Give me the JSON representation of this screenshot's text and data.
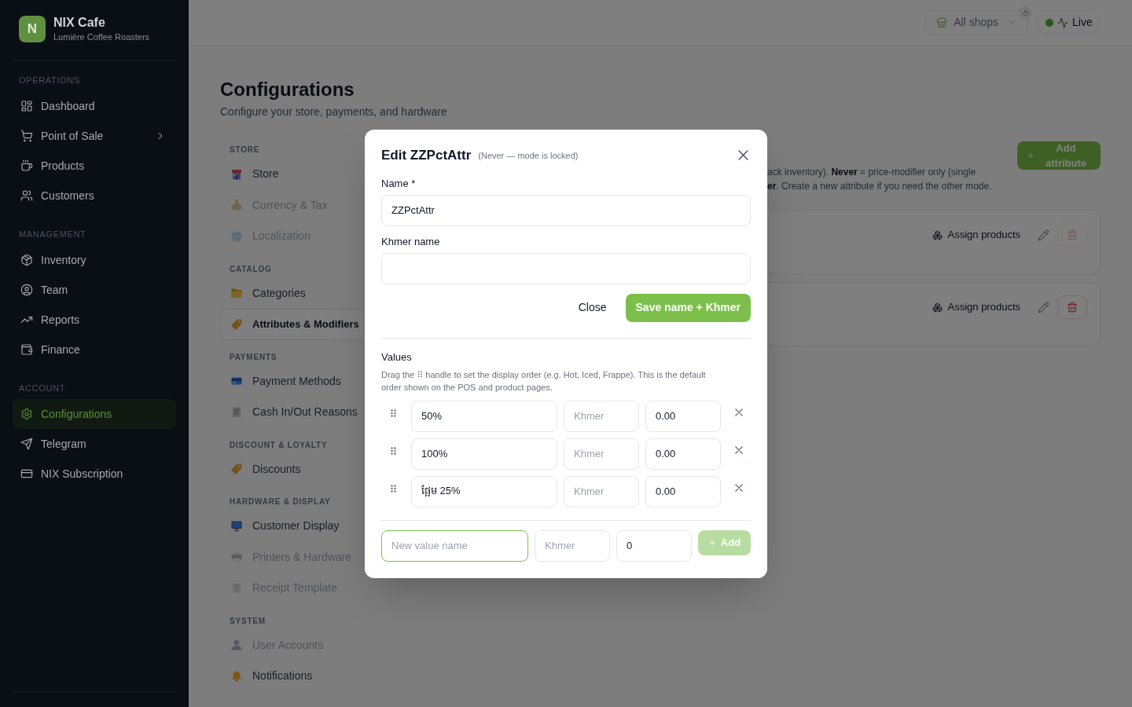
{
  "sidebar": {
    "brand": {
      "initial": "N",
      "name": "NIX Cafe",
      "tagline": "Lumière Coffee Roasters"
    },
    "sections": [
      {
        "title": "OPERATIONS",
        "items": [
          {
            "label": "Dashboard",
            "selected": false,
            "expandable": false
          },
          {
            "label": "Point of Sale",
            "selected": false,
            "expandable": true
          },
          {
            "label": "Products",
            "selected": false,
            "expandable": false
          },
          {
            "label": "Customers",
            "selected": false,
            "expandable": false
          }
        ]
      },
      {
        "title": "MANAGEMENT",
        "items": [
          {
            "label": "Inventory",
            "selected": false,
            "expandable": false
          },
          {
            "label": "Team",
            "selected": false,
            "expandable": false
          },
          {
            "label": "Reports",
            "selected": false,
            "expandable": false
          },
          {
            "label": "Finance",
            "selected": false,
            "expandable": false
          }
        ]
      },
      {
        "title": "ACCOUNT",
        "items": [
          {
            "label": "Configurations",
            "selected": true,
            "expandable": false
          },
          {
            "label": "Telegram",
            "selected": false,
            "expandable": false
          },
          {
            "label": "NIX Subscription",
            "selected": false,
            "expandable": false
          }
        ]
      }
    ]
  },
  "header": {
    "shop_selector": {
      "label": "All shops",
      "locked": true
    },
    "live_status": {
      "label": "Live",
      "on": true
    }
  },
  "page": {
    "title": "Configurations",
    "subtitle": "Configure your store, payments, and hardware"
  },
  "config_nav": {
    "sections": [
      {
        "title": "STORE",
        "items": [
          {
            "label": "Store",
            "selected": false,
            "disabled": false
          },
          {
            "label": "Currency & Tax",
            "selected": false,
            "disabled": true
          },
          {
            "label": "Localization",
            "selected": false,
            "disabled": true
          }
        ]
      },
      {
        "title": "CATALOG",
        "items": [
          {
            "label": "Categories",
            "selected": false,
            "disabled": false
          },
          {
            "label": "Attributes & Modifiers",
            "selected": true,
            "disabled": false
          }
        ]
      },
      {
        "title": "PAYMENTS",
        "items": [
          {
            "label": "Payment Methods",
            "selected": false,
            "disabled": false
          },
          {
            "label": "Cash In/Out Reasons",
            "selected": false,
            "disabled": false
          }
        ]
      },
      {
        "title": "DISCOUNT & LOYALTY",
        "items": [
          {
            "label": "Discounts",
            "selected": false,
            "disabled": false
          }
        ]
      },
      {
        "title": "HARDWARE & DISPLAY",
        "items": [
          {
            "label": "Customer Display",
            "selected": false,
            "disabled": false
          },
          {
            "label": "Printers & Hardware",
            "selected": false,
            "disabled": true
          },
          {
            "label": "Receipt Template",
            "selected": false,
            "disabled": true
          }
        ]
      },
      {
        "title": "SYSTEM",
        "items": [
          {
            "label": "User Accounts",
            "selected": false,
            "disabled": true
          },
          {
            "label": "Notifications",
            "selected": false,
            "disabled": false
          }
        ]
      }
    ]
  },
  "attributes_panel": {
    "add_button": "Add attribute",
    "description_lines": [
      "ack inventory). **Never** = price-modifier only (single",
      "**er**. Create a new attribute if you need the other mode."
    ],
    "cards": [
      {
        "assign_label": "Assign products",
        "delete_disabled": true
      },
      {
        "assign_label": "Assign products",
        "delete_disabled": false
      }
    ]
  },
  "modal": {
    "title": "Edit ZZPctAttr",
    "note": "(Never — mode is locked)",
    "fields": [
      {
        "label": "Name *",
        "value": "ZZPctAttr"
      },
      {
        "label": "Khmer name"
      }
    ],
    "close_button": "Close",
    "save_button": "Save name + Khmer",
    "values": {
      "label": "Values",
      "help": "Drag the ⠿ handle to set the display order (e.g. Hot, Iced, Frappe). This is the default order shown on the POS and product pages.",
      "rows": [
        {
          "name": "50%",
          "khmer_placeholder": "Khmer",
          "price": "0.00"
        },
        {
          "name": "100%",
          "khmer_placeholder": "Khmer",
          "price": "0.00"
        },
        {
          "name": "ផ្អែម 25%",
          "khmer_placeholder": "Khmer",
          "price": "0.00"
        }
      ],
      "new_row": {
        "name_placeholder": "New value name",
        "focused": true,
        "khmer_placeholder": "Khmer",
        "price": "0",
        "add_label": "Add",
        "add_disabled": true
      }
    }
  }
}
